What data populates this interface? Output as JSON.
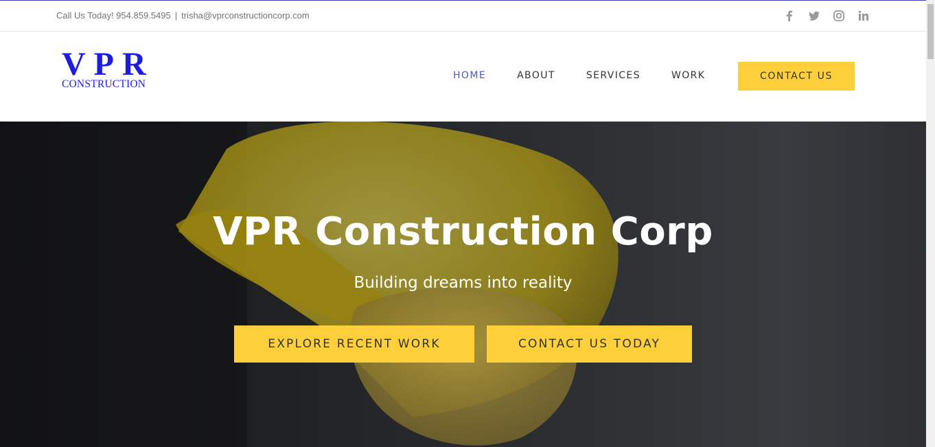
{
  "topbar": {
    "call_text": "Call Us Today! 954.859.5495",
    "separator": "|",
    "email": "trisha@vprconstructioncorp.com",
    "social_icons": [
      "facebook-icon",
      "twitter-icon",
      "instagram-icon",
      "linkedin-icon"
    ]
  },
  "logo": {
    "main": "VPR",
    "sub": "CONSTRUCTION",
    "color": "#1d1de0"
  },
  "nav": {
    "items": [
      {
        "label": "HOME",
        "active": true
      },
      {
        "label": "ABOUT",
        "active": false
      },
      {
        "label": "SERVICES",
        "active": false
      },
      {
        "label": "WORK",
        "active": false
      }
    ],
    "cta": "CONTACT US"
  },
  "hero": {
    "title": "VPR Construction Corp",
    "subtitle": "Building dreams into reality",
    "buttons": [
      "EXPLORE RECENT WORK",
      "CONTACT US TODAY"
    ]
  },
  "colors": {
    "accent": "#fdd03b",
    "nav_active": "#4c5bad",
    "brand_blue": "#1d1de0"
  }
}
